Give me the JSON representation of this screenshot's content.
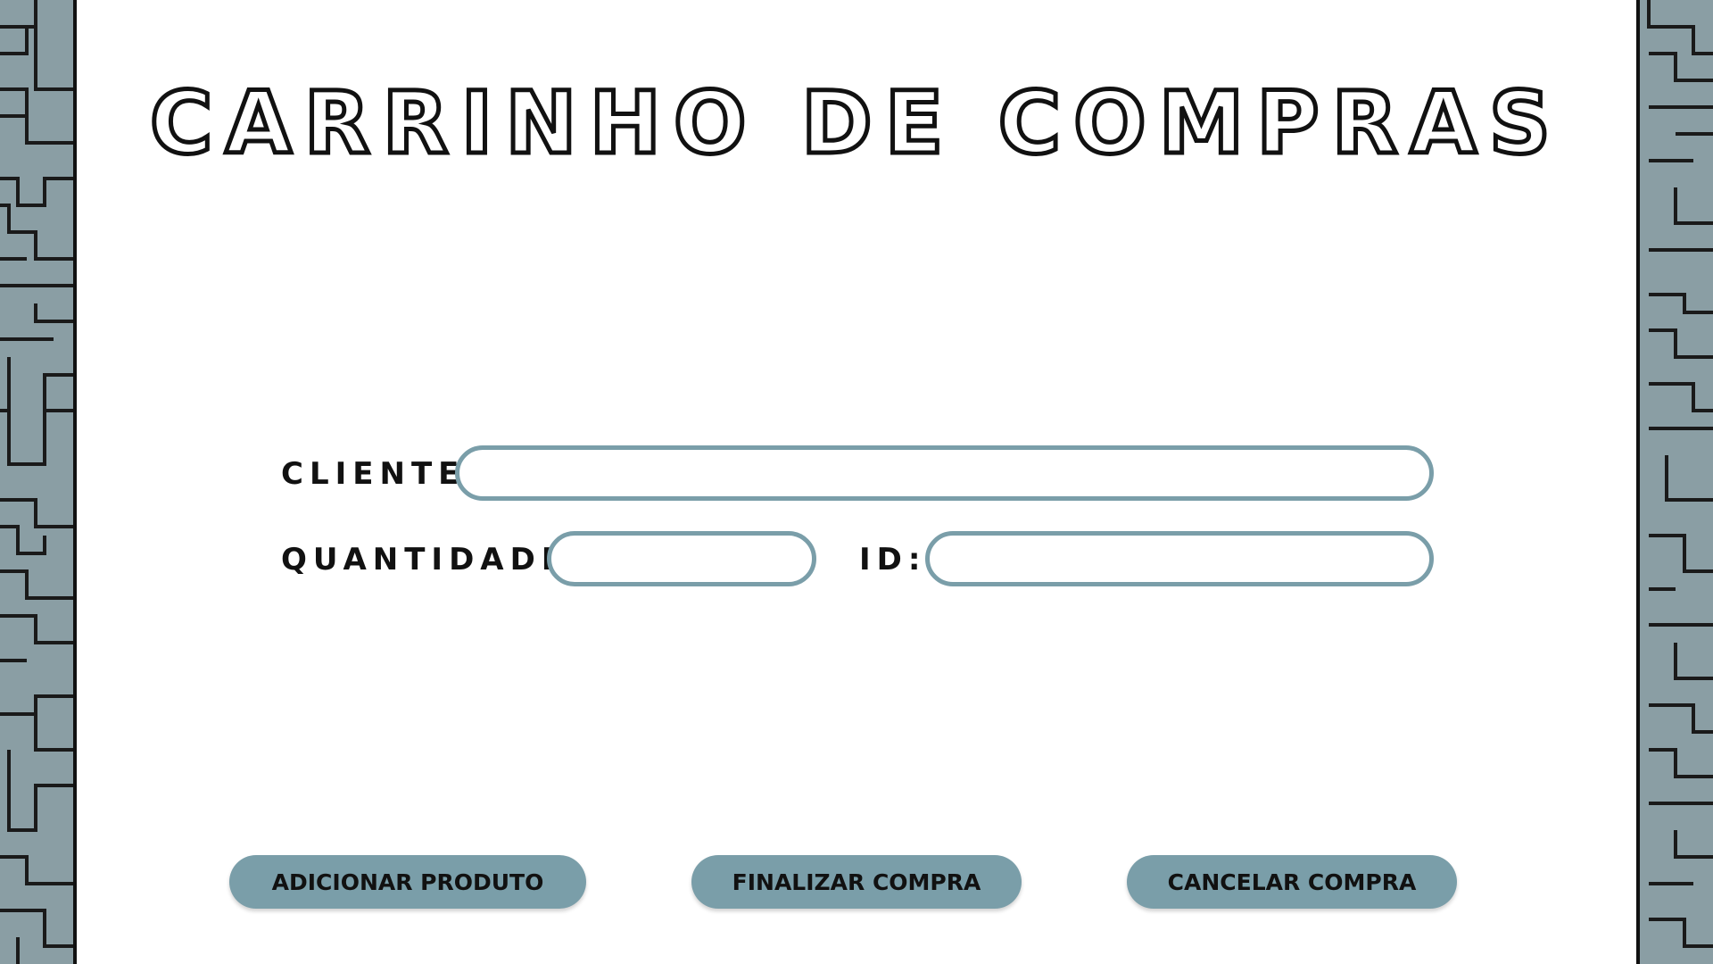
{
  "header": {
    "title": "CARRINHO DE COMPRAS"
  },
  "form": {
    "cliente_label": "CLIENTE:",
    "cliente_value": "",
    "quantidade_label": "QUANTIDADE:",
    "quantidade_value": "",
    "id_label": "ID:",
    "id_value": ""
  },
  "actions": {
    "add_label": "ADICIONAR PRODUTO",
    "finish_label": "FINALIZAR COMPRA",
    "cancel_label": "CANCELAR COMPRA"
  },
  "colors": {
    "accent": "#7a9ea9",
    "panel": "#8a9ea4",
    "text": "#111111",
    "background": "#ffffff"
  }
}
